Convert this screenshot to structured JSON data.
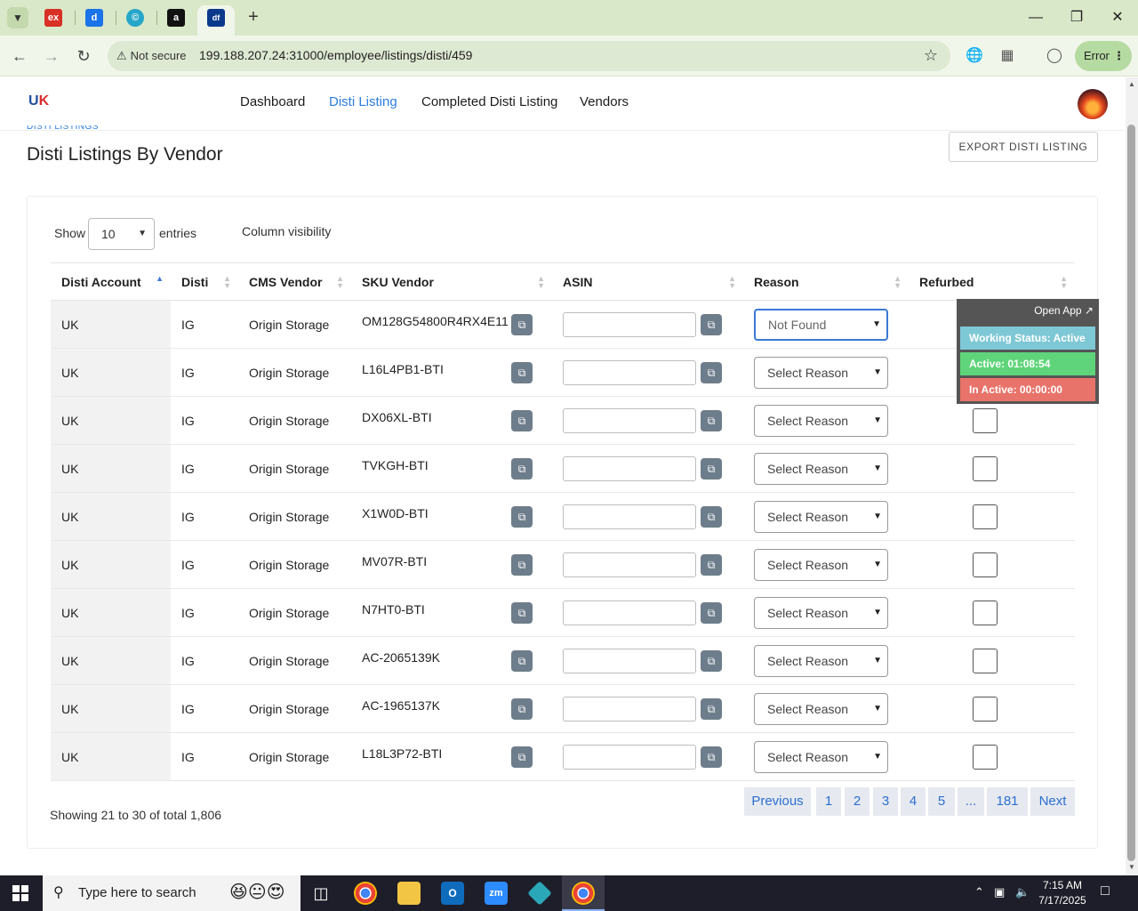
{
  "browser": {
    "security_label": "Not secure",
    "url": "199.188.207.24:31000/employee/listings/disti/459",
    "profile_button": "Error"
  },
  "app": {
    "nav": [
      "Dashboard",
      "Disti Listing",
      "Completed Disti Listing",
      "Vendors"
    ],
    "active_nav": "Disti Listing",
    "breadcrumb": "DISTI LISTINGS",
    "page_title": "Disti Listings By Vendor",
    "export_label": "EXPORT DISTI LISTING"
  },
  "controls": {
    "show_label": "Show",
    "entries_value": "10",
    "entries_label": "entries",
    "column_visibility": "Column visibility"
  },
  "table": {
    "columns": [
      "Disti Account",
      "Disti",
      "CMS Vendor",
      "SKU Vendor",
      "ASIN",
      "Reason",
      "Refurbed"
    ],
    "rows": [
      {
        "account": "UK",
        "disti": "IG",
        "vendor": "Origin Storage",
        "sku": "OM128G54800R4RX4E11",
        "reason": "Not Found"
      },
      {
        "account": "UK",
        "disti": "IG",
        "vendor": "Origin Storage",
        "sku": "L16L4PB1-BTI",
        "reason": "Select Reason"
      },
      {
        "account": "UK",
        "disti": "IG",
        "vendor": "Origin Storage",
        "sku": "DX06XL-BTI",
        "reason": "Select Reason"
      },
      {
        "account": "UK",
        "disti": "IG",
        "vendor": "Origin Storage",
        "sku": "TVKGH-BTI",
        "reason": "Select Reason"
      },
      {
        "account": "UK",
        "disti": "IG",
        "vendor": "Origin Storage",
        "sku": "X1W0D-BTI",
        "reason": "Select Reason"
      },
      {
        "account": "UK",
        "disti": "IG",
        "vendor": "Origin Storage",
        "sku": "MV07R-BTI",
        "reason": "Select Reason"
      },
      {
        "account": "UK",
        "disti": "IG",
        "vendor": "Origin Storage",
        "sku": "N7HT0-BTI",
        "reason": "Select Reason"
      },
      {
        "account": "UK",
        "disti": "IG",
        "vendor": "Origin Storage",
        "sku": "AC-2065139K",
        "reason": "Select Reason"
      },
      {
        "account": "UK",
        "disti": "IG",
        "vendor": "Origin Storage",
        "sku": "AC-1965137K",
        "reason": "Select Reason"
      },
      {
        "account": "UK",
        "disti": "IG",
        "vendor": "Origin Storage",
        "sku": "L18L3P72-BTI",
        "reason": "Select Reason"
      }
    ]
  },
  "footer": {
    "showing_text": "Showing 21 to 30 of total 1,806",
    "pages": [
      "Previous",
      "1",
      "2",
      "3",
      "4",
      "5",
      "...",
      "181",
      "Next"
    ]
  },
  "status_widget": {
    "open_app": "Open App ↗",
    "working_status": "Working Status: Active",
    "active_time": "Active: 01:08:54",
    "inactive_time": "In Active: 00:00:00",
    "colors": {
      "working": "#7ec8d6",
      "active": "#5fd47a",
      "inactive": "#e8736a"
    }
  },
  "taskbar": {
    "search_placeholder": "Type here to search",
    "time": "7:15 AM",
    "date": "7/17/2025"
  }
}
